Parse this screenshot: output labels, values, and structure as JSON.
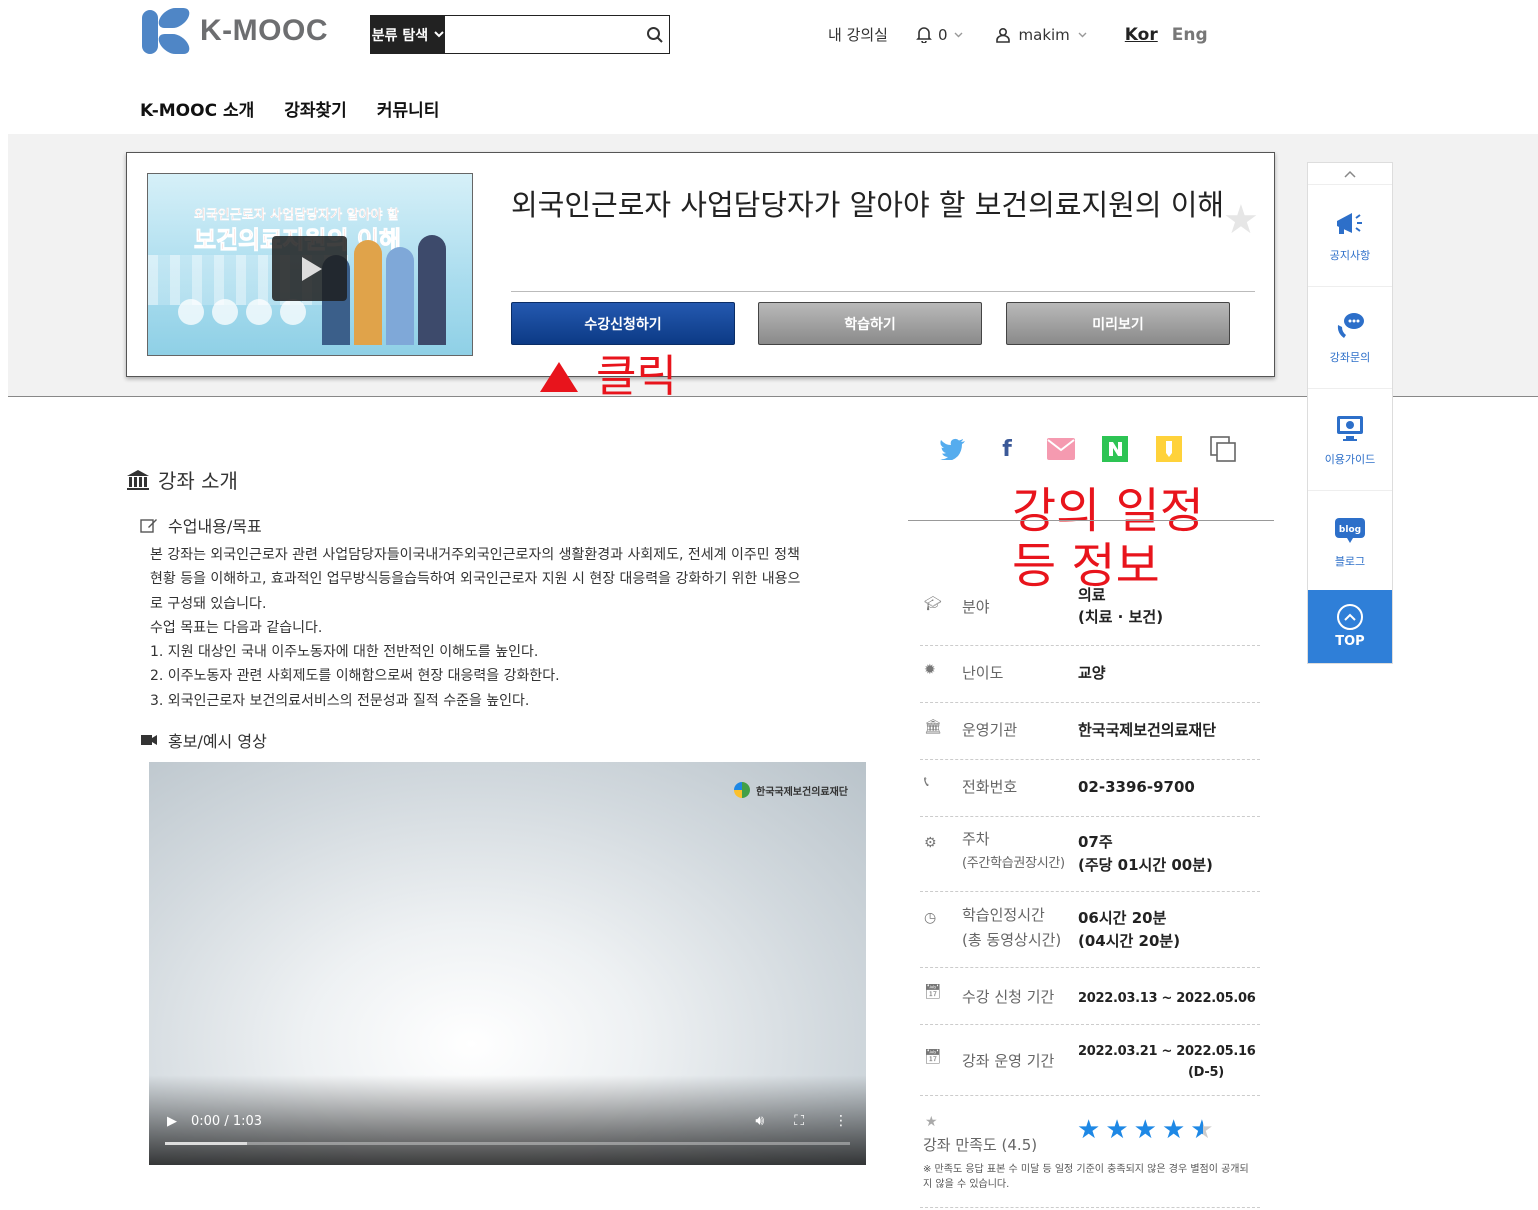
{
  "header": {
    "logo_text": "K-MOOC",
    "search_category": "분류 탐색",
    "search_placeholder": "",
    "my_classroom": "내 강의실",
    "notifications": "0",
    "username": "makim",
    "lang_kor": "Kor",
    "lang_eng": "Eng"
  },
  "mainnav": [
    "K-MOOC 소개",
    "강좌찾기",
    "커뮤니티"
  ],
  "course": {
    "title": "외국인근로자 사업담당자가 알아야 할 보건의료지원의 이해",
    "thumb_line1": "외국인근로자 사업담당자가 알아야 할",
    "thumb_line2": "보건의료지원의 이해",
    "buttons": {
      "enroll": "수강신청하기",
      "study": "학습하기",
      "preview": "미리보기"
    }
  },
  "annotations": {
    "click": "클릭",
    "info_line1": "강의 일정",
    "info_line2": "등 정보"
  },
  "quick_menu": {
    "items": [
      "공지사항",
      "강좌문의",
      "이용가이드",
      "블로그"
    ],
    "top": "TOP"
  },
  "intro": {
    "section_title": "강좌 소개",
    "content_title": "수업내용/목표",
    "paragraph": [
      "본 강좌는 외국인근로자 관련 사업담당자들이국내거주외국인근로자의 생활환경과 사회제도, 전세계 이주민 정책",
      "현황 등을 이해하고, 효과적인 업무방식등을습득하여 외국인근로자 지원 시 현장 대응력을 강화하기 위한 내용으",
      "로 구성돼 있습니다.",
      "수업 목표는 다음과 같습니다.",
      "1. 지원 대상인 국내 이주노동자에 대한 전반적인 이해도를 높인다.",
      "2. 이주노동자 관련 사회제도를 이해함으로써 현장 대응력을 강화한다.",
      "3. 외국인근로자 보건의료서비스의 전문성과 질적 수준을 높인다."
    ],
    "video_title": "홍보/예시 영상",
    "video_brand": "한국국제보건의료재단",
    "video_time": "0:00 / 1:03",
    "video_progress": 0.12
  },
  "info": {
    "field_label": "분야",
    "field_value1": "의료",
    "field_value2": "(치료 · 보건)",
    "level_label": "난이도",
    "level_value": "교양",
    "org_label": "운영기관",
    "org_value": "한국국제보건의료재단",
    "phone_label": "전화번호",
    "phone_value": "02-3396-9700",
    "week_label1": "주차",
    "week_label2": "(주간학습권장시간)",
    "week_value1": "07주",
    "week_value2": "(주당 01시간 00분)",
    "time_label1": "학습인정시간",
    "time_label2": "(총 동영상시간)",
    "time_value1": "06시간 20분",
    "time_value2": "(04시간 20분)",
    "enroll_label": "수강 신청 기간",
    "enroll_value": "2022.03.13 ~ 2022.05.06",
    "run_label": "강좌 운영 기간",
    "run_value1": "2022.03.21 ~ 2022.05.16",
    "run_value2": "(D-5)",
    "rating_label": "강좌 만족도 (4.5)",
    "rating_value": 4.5,
    "rating_note": "※ 만족도 응답 표본 수 미달 등 일정 기준이 충족되지 않은 경우 별점이 공개되지 않을 수 있습니다."
  },
  "colors": {
    "enroll_button": "#0c3a85",
    "annotation_red": "#e8141c",
    "quick_top": "#2f7fd8",
    "star_blue": "#1e88e5"
  }
}
